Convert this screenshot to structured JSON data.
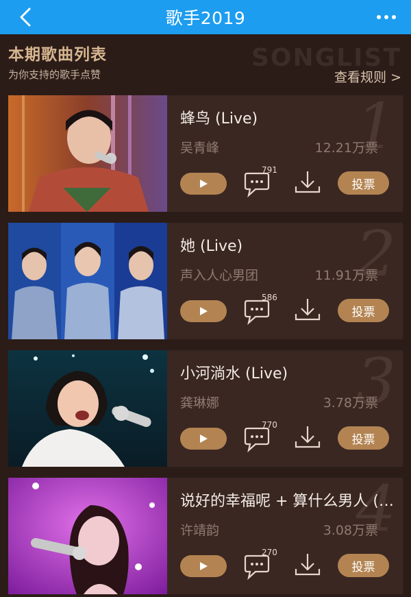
{
  "topbar": {
    "title": "歌手2019",
    "back_icon": "chevron-left-icon",
    "more_icon": "more-dots-icon",
    "color": "#1d9df0"
  },
  "header": {
    "title": "本期歌曲列表",
    "subtitle": "为你支持的歌手点赞",
    "watermark": "SONGLIST",
    "rules_link": "查看规则 >"
  },
  "songs": [
    {
      "rank": "1",
      "title": "蜂鸟 (Live)",
      "artist": "吴青峰",
      "votes": "12.21万票",
      "comments": "791",
      "vote_label": "投票"
    },
    {
      "rank": "2",
      "title": "她 (Live)",
      "artist": "声入人心男团",
      "votes": "11.91万票",
      "comments": "586",
      "vote_label": "投票"
    },
    {
      "rank": "3",
      "title": "小河淌水 (Live)",
      "artist": "龚琳娜",
      "votes": "3.78万票",
      "comments": "770",
      "vote_label": "投票"
    },
    {
      "rank": "4",
      "title": "说好的幸福呢 + 算什么男人 (Live)",
      "artist": "许靖韵",
      "votes": "3.08万票",
      "comments": "270",
      "vote_label": "投票"
    }
  ],
  "colors": {
    "background": "#2b1c18",
    "card": "#3a2722",
    "accent": "#b38452"
  }
}
